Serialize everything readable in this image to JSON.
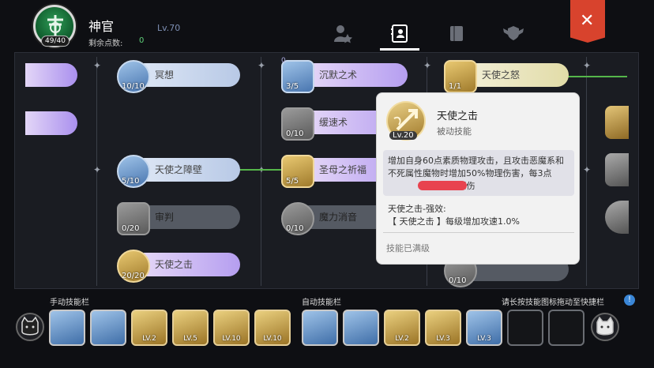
{
  "header": {
    "class_name": "神官",
    "level": "Lv.70",
    "points_label": "剩余点数:",
    "points_value": "0",
    "points_badge": "49/40"
  },
  "close": {
    "label": "✕"
  },
  "tree": {
    "col1": [
      {
        "name": "冥想",
        "count": "10/10"
      },
      {
        "name": "天使之障壁",
        "count": "5/10"
      },
      {
        "name": "审判",
        "count": "0/20"
      },
      {
        "name": "天使之击",
        "count": "20/20"
      }
    ],
    "col2": [
      {
        "name": "沉默之术",
        "count": "3/5",
        "badge": "0"
      },
      {
        "name": "缓速术",
        "count": "0/10"
      },
      {
        "name": "圣母之祈福",
        "count": "5/5"
      },
      {
        "name": "魔力消音",
        "count": "0/10"
      }
    ],
    "col3": [
      {
        "name": "天使之怒",
        "count": "1/1"
      },
      {
        "name": "",
        "count": "0/10"
      }
    ]
  },
  "tooltip": {
    "name": "天使之击",
    "type": "被动技能",
    "lv": "Lv.20",
    "desc": "增加自身60点素质物理攻击，且攻击恶魔系和不死属性魔物时增加50%物理伤害，每3点",
    "desc_tail": "%爆伤",
    "enh_title": "天使之击-强效:",
    "enh_desc": "【 天使之击 】每级增加攻速1.0%",
    "status": "技能已满级"
  },
  "bar": {
    "manual_label": "手动技能栏",
    "auto_label": "自动技能栏",
    "hint": "请长按技能图标拖动至快捷栏",
    "hint_icon": "!",
    "manual_slots": [
      "",
      "",
      "LV.2",
      "LV.5",
      "LV.10",
      "LV.10"
    ],
    "auto_slots": [
      "",
      "",
      "LV.2",
      "LV.3",
      "LV.3"
    ]
  }
}
